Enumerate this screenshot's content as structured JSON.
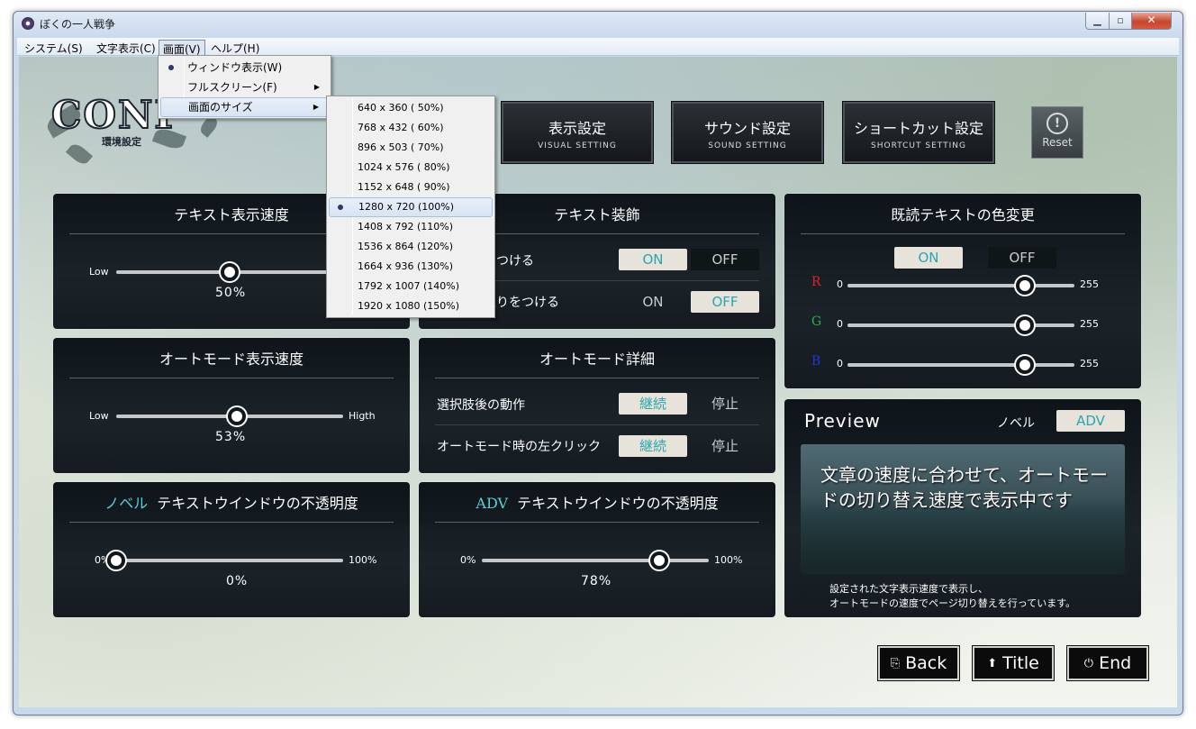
{
  "window": {
    "title": "ぼくの一人戦争"
  },
  "menubar": {
    "items": [
      {
        "label": "システム(S)"
      },
      {
        "label": "文字表示(C)"
      },
      {
        "label": "画面(V)"
      },
      {
        "label": "ヘルプ(H)"
      }
    ]
  },
  "screen_menu": {
    "items": [
      {
        "label": "ウィンドウ表示(W)",
        "checked": true
      },
      {
        "label": "フルスクリーン(F)",
        "submenu": true
      },
      {
        "label": "画面のサイズ",
        "submenu": true
      }
    ]
  },
  "size_menu": {
    "items": [
      {
        "label": "640 x 360 ( 50%)"
      },
      {
        "label": "768 x 432 ( 60%)"
      },
      {
        "label": "896 x 503 ( 70%)"
      },
      {
        "label": "1024 x 576 ( 80%)"
      },
      {
        "label": "1152 x 648 ( 90%)"
      },
      {
        "label": "1280 x 720 (100%)",
        "checked": true
      },
      {
        "label": "1408 x 792 (110%)"
      },
      {
        "label": "1536 x 864 (120%)"
      },
      {
        "label": "1664 x 936 (130%)"
      },
      {
        "label": "1792 x 1007 (140%)"
      },
      {
        "label": "1920 x 1080 (150%)"
      }
    ]
  },
  "logo": {
    "text": "CONF",
    "sub": "環境設定"
  },
  "tabs": [
    {
      "jp": "表示設定",
      "en": "VISUAL SETTING"
    },
    {
      "jp": "サウンド設定",
      "en": "SOUND SETTING"
    },
    {
      "jp": "ショートカット設定",
      "en": "SHORTCUT SETTING"
    }
  ],
  "reset": {
    "label": "Reset",
    "icon": "!"
  },
  "text_speed": {
    "title": "テキスト表示速度",
    "low": "Low",
    "value_text": "50%",
    "value": 0.5
  },
  "text_deco": {
    "title": "テキスト装飾",
    "rows": [
      {
        "label": "影をつける",
        "visible_label": "をつける",
        "on": "ON",
        "off": "OFF",
        "selected": "on"
      },
      {
        "label": "縁取りをつける",
        "visible_label": "取りをつける",
        "on": "ON",
        "off": "OFF",
        "selected": "off"
      }
    ]
  },
  "read_color": {
    "title": "既読テキストの色変更",
    "on": "ON",
    "off": "OFF",
    "selected": "on",
    "channels": [
      {
        "letter": "R",
        "min": "0",
        "max": "255",
        "value": 0.78,
        "color": "#e0222a"
      },
      {
        "letter": "G",
        "min": "0",
        "max": "255",
        "value": 0.78,
        "color": "#27b24a"
      },
      {
        "letter": "B",
        "min": "0",
        "max": "255",
        "value": 0.78,
        "color": "#2236d8"
      }
    ]
  },
  "auto_speed": {
    "title": "オートモード表示速度",
    "low": "Low",
    "high": "Higth",
    "value_text": "53%",
    "value": 0.53
  },
  "auto_detail": {
    "title": "オートモード詳細",
    "rows": [
      {
        "label": "選択肢後の動作",
        "on": "継続",
        "off": "停止",
        "selected": "on"
      },
      {
        "label": "オートモード時の左クリック",
        "on": "継続",
        "off": "停止",
        "selected": "on"
      }
    ]
  },
  "novel_opacity": {
    "hl": "ノベル",
    "title": "テキストウインドウの不透明度",
    "min": "0%",
    "max": "100%",
    "value_text": "0%",
    "value": 0.0
  },
  "adv_opacity": {
    "hl": "ADV",
    "title": "テキストウインドウの不透明度",
    "min": "0%",
    "max": "100%",
    "value_text": "78%",
    "value": 0.78
  },
  "preview": {
    "title": "Preview",
    "mode_novel": "ノベル",
    "mode_adv": "ADV",
    "selected": "adv",
    "text": "文章の速度に合わせて、オートモードの切り替え速度で表示中です",
    "caption1": "設定された文字表示速度で表示し、",
    "caption2": "オートモードの速度でページ切り替えを行っています。"
  },
  "bottom": [
    {
      "label": "Back",
      "icon": "back-icon"
    },
    {
      "label": "Title",
      "icon": "up-arrow-icon"
    },
    {
      "label": "End",
      "icon": "power-icon"
    }
  ],
  "colors": {
    "accent": "#5ecdd6",
    "panel": "#151b20",
    "toggle_on_bg": "#e8e3da"
  }
}
